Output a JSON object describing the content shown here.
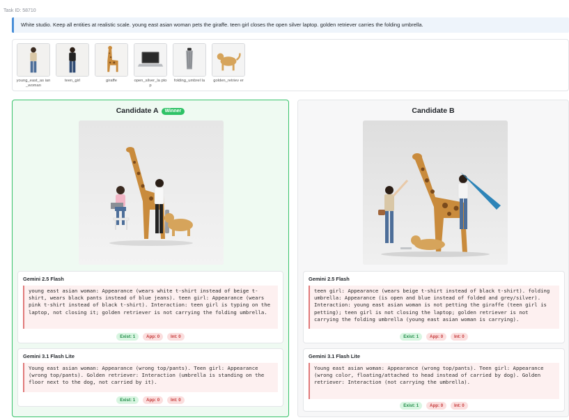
{
  "task_id": "Task ID: 58710",
  "prompt": "White studio. Keep all entities at realistic scale. young east asian woman pets the giraffe. teen girl closes the open silver laptop. golden retriever carries the folding umbrella.",
  "references": [
    {
      "label": "young_east_as ian_woman",
      "icon": "woman-figure-icon"
    },
    {
      "label": "teen_girl",
      "icon": "girl-figure-icon"
    },
    {
      "label": "giraffe",
      "icon": "giraffe-icon"
    },
    {
      "label": "open_silver_la ptop",
      "icon": "laptop-icon"
    },
    {
      "label": "folding_umbrel la",
      "icon": "umbrella-icon"
    },
    {
      "label": "golden_retriev er",
      "icon": "dog-icon"
    }
  ],
  "candidate_a": {
    "title": "Candidate A",
    "badge": "Winner",
    "evals": [
      {
        "model": "Gemini 2.5 Flash",
        "text": "young east asian woman: Appearance (wears white t-shirt instead of beige t-shirt, wears black pants instead of blue jeans). teen girl: Appearance (wears pink t-shirt instead of black t-shirt). Interaction: teen girl is typing on the laptop, not closing it; golden retriever is not carrying the folding umbrella.",
        "exist": "Exist: 1",
        "app": "App: 0",
        "int": "Int: 0"
      },
      {
        "model": "Gemini 3.1 Flash Lite",
        "text": "Young east asian woman: Appearance (wrong top/pants). Teen girl: Appearance (wrong top/pants). Golden retriever: Interaction (umbrella is standing on the floor next to the dog, not carried by it).",
        "exist": "Exist: 1",
        "app": "App: 0",
        "int": "Int: 0"
      }
    ]
  },
  "candidate_b": {
    "title": "Candidate B",
    "evals": [
      {
        "model": "Gemini 2.5 Flash",
        "text": "teen girl: Appearance (wears beige t-shirt instead of black t-shirt). folding umbrella: Appearance (is open and blue instead of folded and grey/silver). Interaction: young east asian woman is not petting the giraffe (teen girl is petting); teen girl is not closing the laptop; golden retriever is not carrying the folding umbrella (young east asian woman is carrying).",
        "exist": "Exist: 1",
        "app": "App: 0",
        "int": "Int: 0"
      },
      {
        "model": "Gemini 3.1 Flash Lite",
        "text": "Young east asian woman: Appearance (wrong top/pants). Teen girl: Appearance (wrong color, floating/attached to head instead of carried by dog). Golden retriever: Interaction (not carrying the umbrella).",
        "exist": "Exist: 1",
        "app": "App: 0",
        "int": "Int: 0"
      }
    ]
  },
  "colors": {
    "winner_green": "#2ec266",
    "prompt_accent": "#4a8fd8",
    "error_red": "#c43838"
  }
}
